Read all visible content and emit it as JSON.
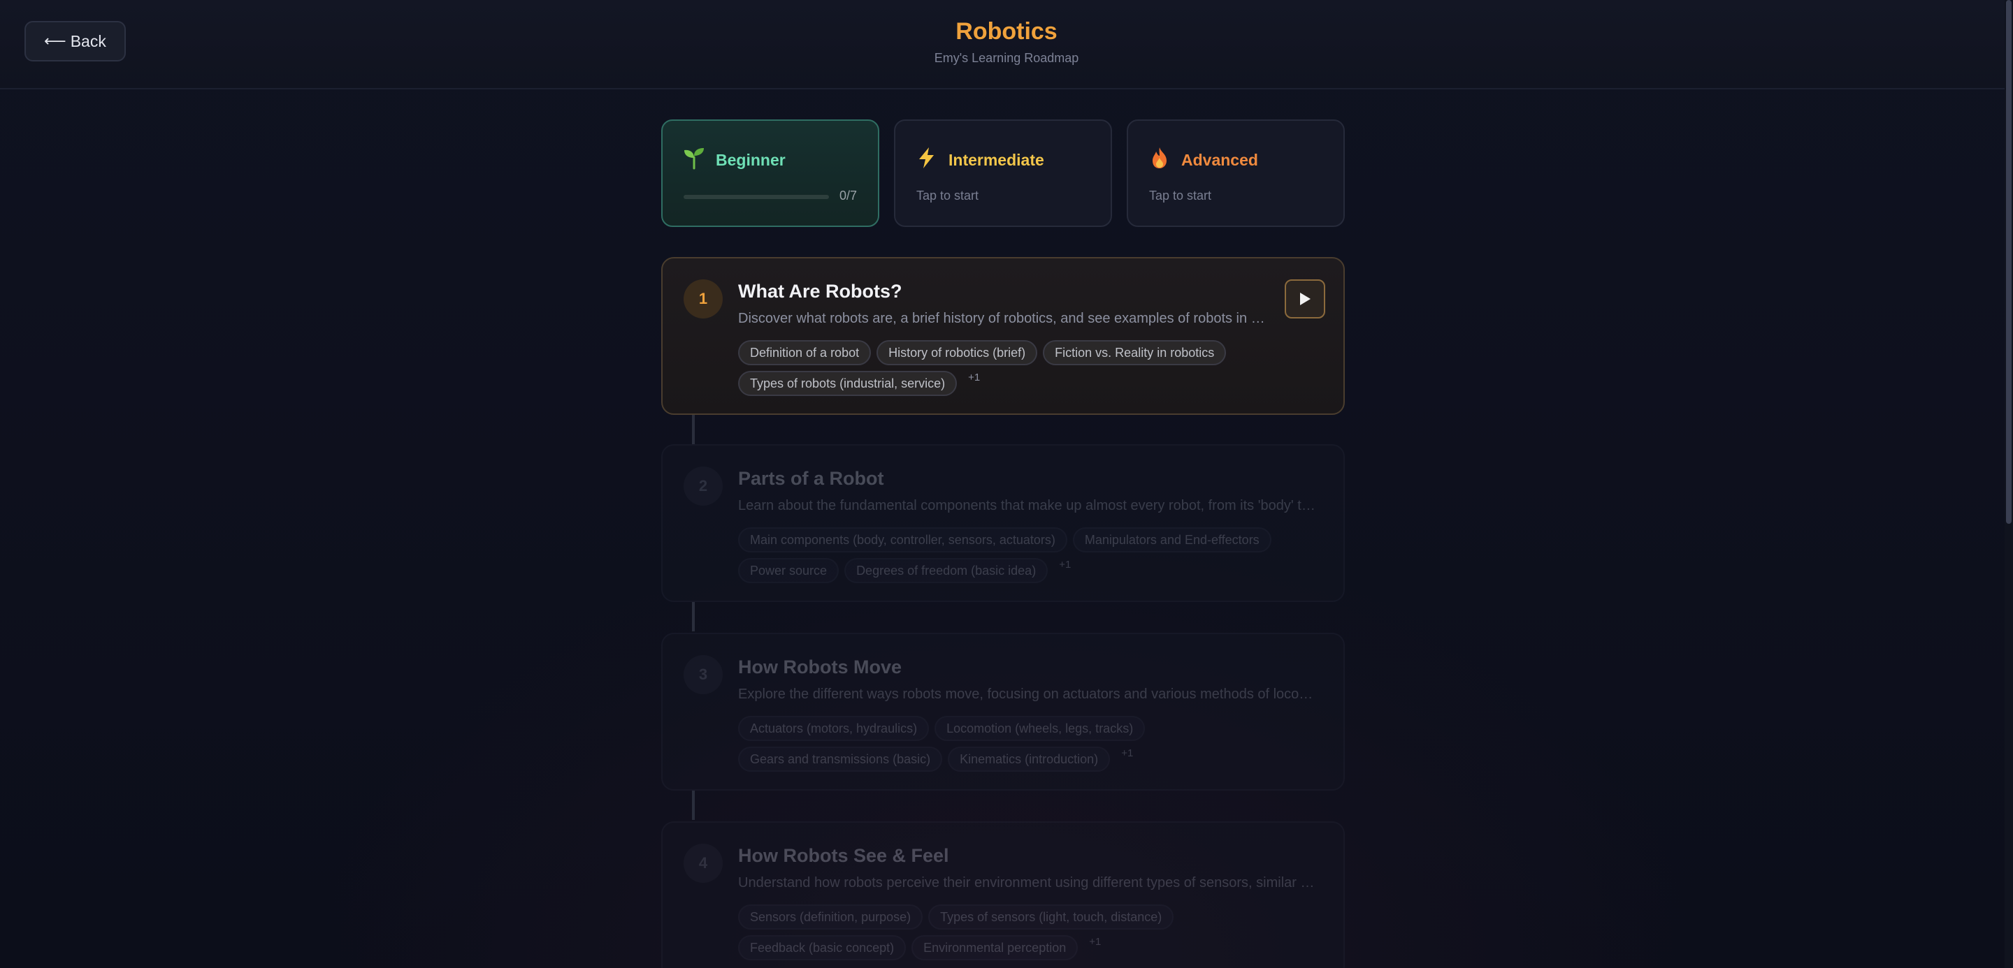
{
  "header": {
    "back_label": "Back",
    "title": "Robotics",
    "subtitle": "Emy's Learning Roadmap"
  },
  "levels": [
    {
      "name": "Beginner",
      "icon": "seedling-icon",
      "progress_text": "0/7",
      "progress": 0,
      "selected": true
    },
    {
      "name": "Intermediate",
      "icon": "lightning-icon",
      "hint": "Tap to start"
    },
    {
      "name": "Advanced",
      "icon": "fire-icon",
      "hint": "Tap to start"
    }
  ],
  "lessons": [
    {
      "number": "1",
      "title": "What Are Robots?",
      "description": "Discover what robots are, a brief history of robotics, and see examples of robots in our everyday world.",
      "tags_row1": [
        "Definition of a robot",
        "History of robotics (brief)",
        "Fiction vs. Reality in robotics"
      ],
      "tags_row2": [
        "Types of robots (industrial, service)"
      ],
      "more": "+1"
    },
    {
      "number": "2",
      "title": "Parts of a Robot",
      "description": "Learn about the fundamental components that make up almost every robot, from its 'body' to its 'brain'.",
      "tags_row1": [
        "Main components (body, controller, sensors, actuators)",
        "Manipulators and End-effectors"
      ],
      "tags_row2": [
        "Power source",
        "Degrees of freedom (basic idea)"
      ],
      "more": "+1"
    },
    {
      "number": "3",
      "title": "How Robots Move",
      "description": "Explore the different ways robots move, focusing on actuators and various methods of locomotion.",
      "tags_row1": [
        "Actuators (motors, hydraulics)",
        "Locomotion (wheels, legs, tracks)"
      ],
      "tags_row2": [
        "Gears and transmissions (basic)",
        "Kinematics (introduction)"
      ],
      "more": "+1"
    },
    {
      "number": "4",
      "title": "How Robots See & Feel",
      "description": "Understand how robots perceive their environment using different types of sensors, similar to our senses.",
      "tags_row1": [
        "Sensors (definition, purpose)",
        "Types of sensors (light, touch, distance)"
      ],
      "tags_row2": [
        "Feedback (basic concept)",
        "Environmental perception"
      ],
      "more": "+1"
    }
  ]
}
